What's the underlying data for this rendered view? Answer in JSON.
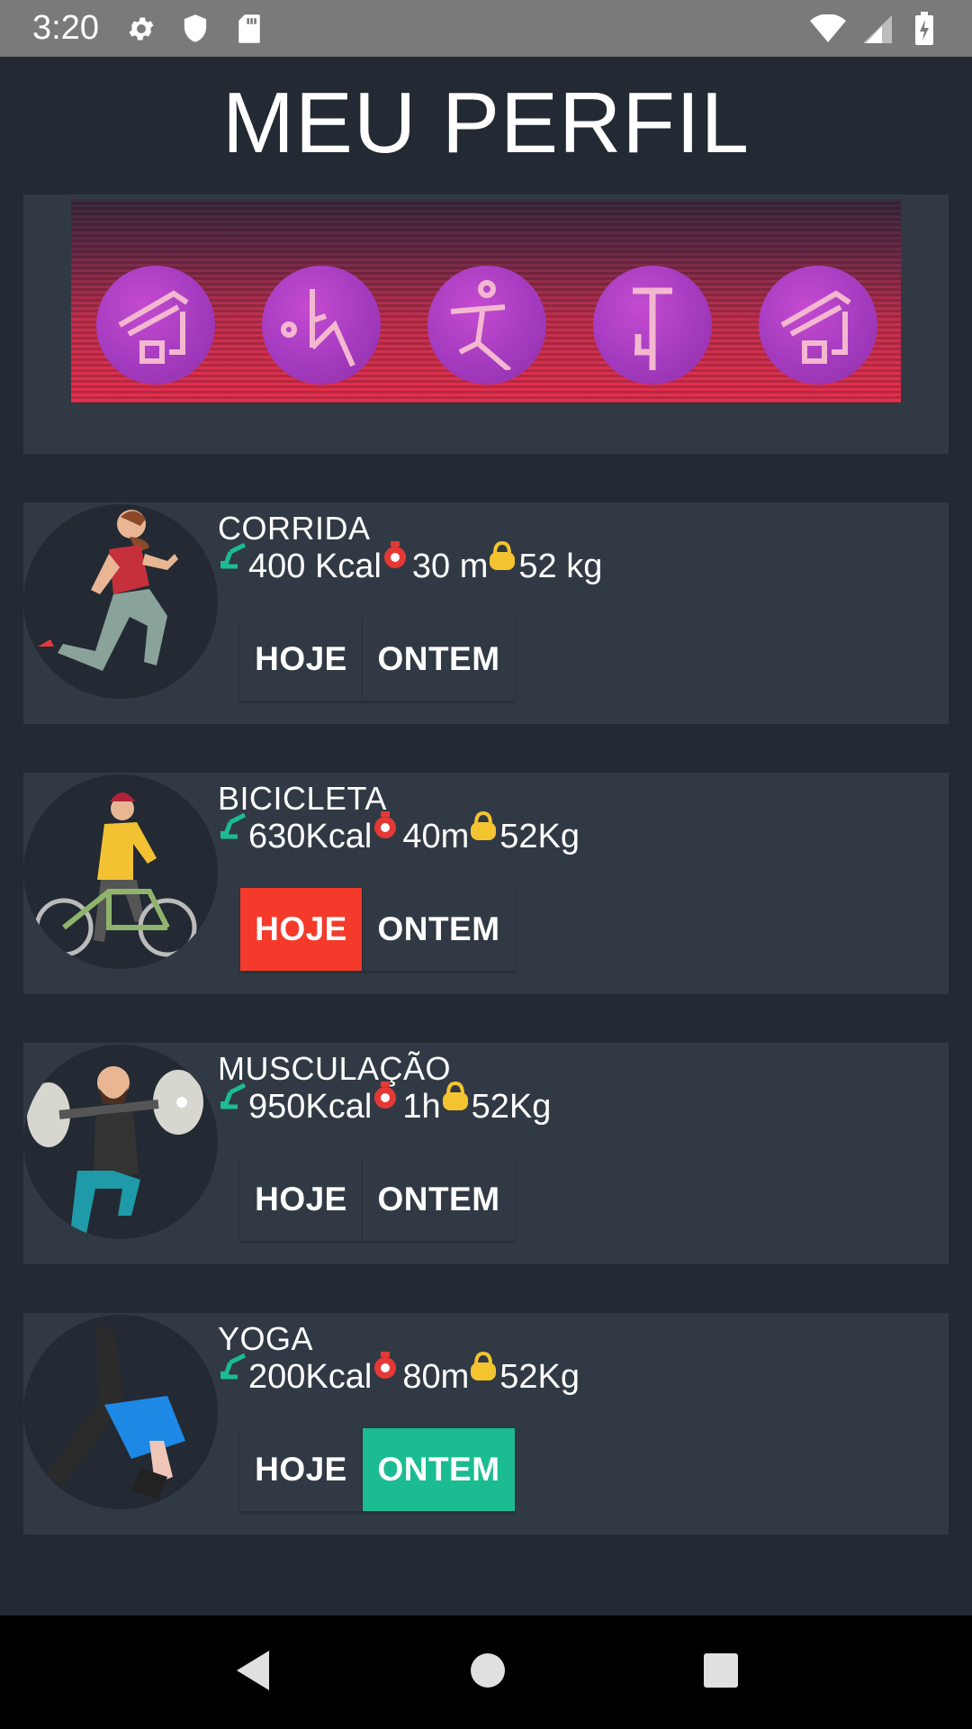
{
  "status_bar": {
    "time": "3:20",
    "left_icons": [
      "settings-icon",
      "shield-icon",
      "sd-card-icon"
    ],
    "right_icons": [
      "wifi-icon",
      "signal-icon",
      "battery-charging-icon"
    ]
  },
  "page": {
    "title": "MEU PERFIL"
  },
  "banner": {
    "icons": [
      "exercise-bike-icon",
      "yoga-icon",
      "running-icon",
      "weightlifting-icon",
      "exercise-bike-icon"
    ],
    "colors": {
      "circle": "#a43bbf",
      "gradient_bottom": "#e6304e"
    }
  },
  "exercises": [
    {
      "name": "CORRIDA",
      "kcal": "400 Kcal",
      "time": "30 m",
      "weight": "52 kg",
      "hoje": "HOJE",
      "ontem": "ONTEM",
      "selected": "none",
      "avatar": "runner-icon"
    },
    {
      "name": "BICICLETA",
      "kcal": "630Kcal",
      "time": "40m",
      "weight": "52Kg",
      "hoje": "HOJE",
      "ontem": "ONTEM",
      "selected": "hoje",
      "avatar": "cyclist-icon"
    },
    {
      "name": "MUSCULAÇÃO",
      "kcal": "950Kcal",
      "time": "1h",
      "weight": "52Kg",
      "hoje": "HOJE",
      "ontem": "ONTEM",
      "selected": "none",
      "avatar": "weightlifter-icon"
    },
    {
      "name": "YOGA",
      "kcal": "200Kcal",
      "time": "80m",
      "weight": "52Kg",
      "hoje": "HOJE",
      "ontem": "ONTEM",
      "selected": "ontem",
      "avatar": "yoga-pose-icon"
    }
  ],
  "colors": {
    "background": "#232a33",
    "card": "#313a44",
    "hoje_active": "#f43a2b",
    "ontem_active": "#1bbc92",
    "kcal_icon": "#1bbc92",
    "time_icon": "#e53935",
    "weight_icon": "#f4c430"
  },
  "nav_bar": {
    "icons": [
      "back-icon",
      "home-icon",
      "recents-icon"
    ]
  }
}
